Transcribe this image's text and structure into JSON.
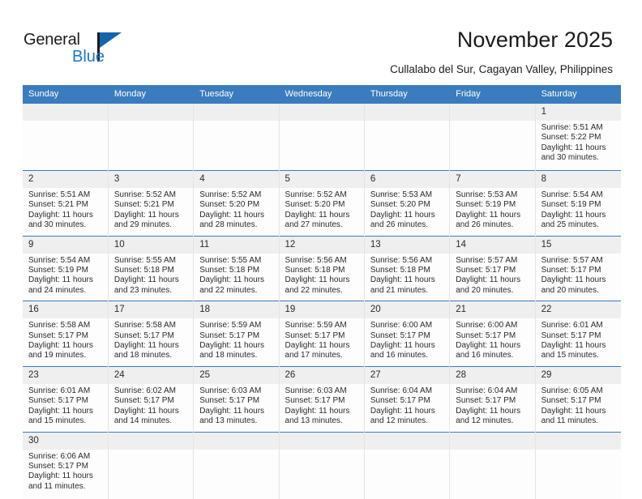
{
  "brand": {
    "name_part1": "General",
    "name_part2": "Blue"
  },
  "header": {
    "title": "November 2025",
    "subtitle": "Cullalabo del Sur, Cagayan Valley, Philippines"
  },
  "colors": {
    "header_blue": "#3a7cbe",
    "logo_blue": "#1165ab",
    "daynum_band": "#efefef",
    "row_rule": "#3a7cbe"
  },
  "calendar": {
    "weekday_headers": [
      "Sunday",
      "Monday",
      "Tuesday",
      "Wednesday",
      "Thursday",
      "Friday",
      "Saturday"
    ],
    "weeks": [
      [
        {
          "day": "",
          "lines": []
        },
        {
          "day": "",
          "lines": []
        },
        {
          "day": "",
          "lines": []
        },
        {
          "day": "",
          "lines": []
        },
        {
          "day": "",
          "lines": []
        },
        {
          "day": "",
          "lines": []
        },
        {
          "day": "1",
          "lines": [
            "Sunrise: 5:51 AM",
            "Sunset: 5:22 PM",
            "Daylight: 11 hours",
            "and 30 minutes."
          ]
        }
      ],
      [
        {
          "day": "2",
          "lines": [
            "Sunrise: 5:51 AM",
            "Sunset: 5:21 PM",
            "Daylight: 11 hours",
            "and 30 minutes."
          ]
        },
        {
          "day": "3",
          "lines": [
            "Sunrise: 5:52 AM",
            "Sunset: 5:21 PM",
            "Daylight: 11 hours",
            "and 29 minutes."
          ]
        },
        {
          "day": "4",
          "lines": [
            "Sunrise: 5:52 AM",
            "Sunset: 5:20 PM",
            "Daylight: 11 hours",
            "and 28 minutes."
          ]
        },
        {
          "day": "5",
          "lines": [
            "Sunrise: 5:52 AM",
            "Sunset: 5:20 PM",
            "Daylight: 11 hours",
            "and 27 minutes."
          ]
        },
        {
          "day": "6",
          "lines": [
            "Sunrise: 5:53 AM",
            "Sunset: 5:20 PM",
            "Daylight: 11 hours",
            "and 26 minutes."
          ]
        },
        {
          "day": "7",
          "lines": [
            "Sunrise: 5:53 AM",
            "Sunset: 5:19 PM",
            "Daylight: 11 hours",
            "and 26 minutes."
          ]
        },
        {
          "day": "8",
          "lines": [
            "Sunrise: 5:54 AM",
            "Sunset: 5:19 PM",
            "Daylight: 11 hours",
            "and 25 minutes."
          ]
        }
      ],
      [
        {
          "day": "9",
          "lines": [
            "Sunrise: 5:54 AM",
            "Sunset: 5:19 PM",
            "Daylight: 11 hours",
            "and 24 minutes."
          ]
        },
        {
          "day": "10",
          "lines": [
            "Sunrise: 5:55 AM",
            "Sunset: 5:18 PM",
            "Daylight: 11 hours",
            "and 23 minutes."
          ]
        },
        {
          "day": "11",
          "lines": [
            "Sunrise: 5:55 AM",
            "Sunset: 5:18 PM",
            "Daylight: 11 hours",
            "and 22 minutes."
          ]
        },
        {
          "day": "12",
          "lines": [
            "Sunrise: 5:56 AM",
            "Sunset: 5:18 PM",
            "Daylight: 11 hours",
            "and 22 minutes."
          ]
        },
        {
          "day": "13",
          "lines": [
            "Sunrise: 5:56 AM",
            "Sunset: 5:18 PM",
            "Daylight: 11 hours",
            "and 21 minutes."
          ]
        },
        {
          "day": "14",
          "lines": [
            "Sunrise: 5:57 AM",
            "Sunset: 5:17 PM",
            "Daylight: 11 hours",
            "and 20 minutes."
          ]
        },
        {
          "day": "15",
          "lines": [
            "Sunrise: 5:57 AM",
            "Sunset: 5:17 PM",
            "Daylight: 11 hours",
            "and 20 minutes."
          ]
        }
      ],
      [
        {
          "day": "16",
          "lines": [
            "Sunrise: 5:58 AM",
            "Sunset: 5:17 PM",
            "Daylight: 11 hours",
            "and 19 minutes."
          ]
        },
        {
          "day": "17",
          "lines": [
            "Sunrise: 5:58 AM",
            "Sunset: 5:17 PM",
            "Daylight: 11 hours",
            "and 18 minutes."
          ]
        },
        {
          "day": "18",
          "lines": [
            "Sunrise: 5:59 AM",
            "Sunset: 5:17 PM",
            "Daylight: 11 hours",
            "and 18 minutes."
          ]
        },
        {
          "day": "19",
          "lines": [
            "Sunrise: 5:59 AM",
            "Sunset: 5:17 PM",
            "Daylight: 11 hours",
            "and 17 minutes."
          ]
        },
        {
          "day": "20",
          "lines": [
            "Sunrise: 6:00 AM",
            "Sunset: 5:17 PM",
            "Daylight: 11 hours",
            "and 16 minutes."
          ]
        },
        {
          "day": "21",
          "lines": [
            "Sunrise: 6:00 AM",
            "Sunset: 5:17 PM",
            "Daylight: 11 hours",
            "and 16 minutes."
          ]
        },
        {
          "day": "22",
          "lines": [
            "Sunrise: 6:01 AM",
            "Sunset: 5:17 PM",
            "Daylight: 11 hours",
            "and 15 minutes."
          ]
        }
      ],
      [
        {
          "day": "23",
          "lines": [
            "Sunrise: 6:01 AM",
            "Sunset: 5:17 PM",
            "Daylight: 11 hours",
            "and 15 minutes."
          ]
        },
        {
          "day": "24",
          "lines": [
            "Sunrise: 6:02 AM",
            "Sunset: 5:17 PM",
            "Daylight: 11 hours",
            "and 14 minutes."
          ]
        },
        {
          "day": "25",
          "lines": [
            "Sunrise: 6:03 AM",
            "Sunset: 5:17 PM",
            "Daylight: 11 hours",
            "and 13 minutes."
          ]
        },
        {
          "day": "26",
          "lines": [
            "Sunrise: 6:03 AM",
            "Sunset: 5:17 PM",
            "Daylight: 11 hours",
            "and 13 minutes."
          ]
        },
        {
          "day": "27",
          "lines": [
            "Sunrise: 6:04 AM",
            "Sunset: 5:17 PM",
            "Daylight: 11 hours",
            "and 12 minutes."
          ]
        },
        {
          "day": "28",
          "lines": [
            "Sunrise: 6:04 AM",
            "Sunset: 5:17 PM",
            "Daylight: 11 hours",
            "and 12 minutes."
          ]
        },
        {
          "day": "29",
          "lines": [
            "Sunrise: 6:05 AM",
            "Sunset: 5:17 PM",
            "Daylight: 11 hours",
            "and 11 minutes."
          ]
        }
      ],
      [
        {
          "day": "30",
          "lines": [
            "Sunrise: 6:06 AM",
            "Sunset: 5:17 PM",
            "Daylight: 11 hours",
            "and 11 minutes."
          ]
        },
        {
          "day": "",
          "lines": []
        },
        {
          "day": "",
          "lines": []
        },
        {
          "day": "",
          "lines": []
        },
        {
          "day": "",
          "lines": []
        },
        {
          "day": "",
          "lines": []
        },
        {
          "day": "",
          "lines": []
        }
      ]
    ]
  }
}
